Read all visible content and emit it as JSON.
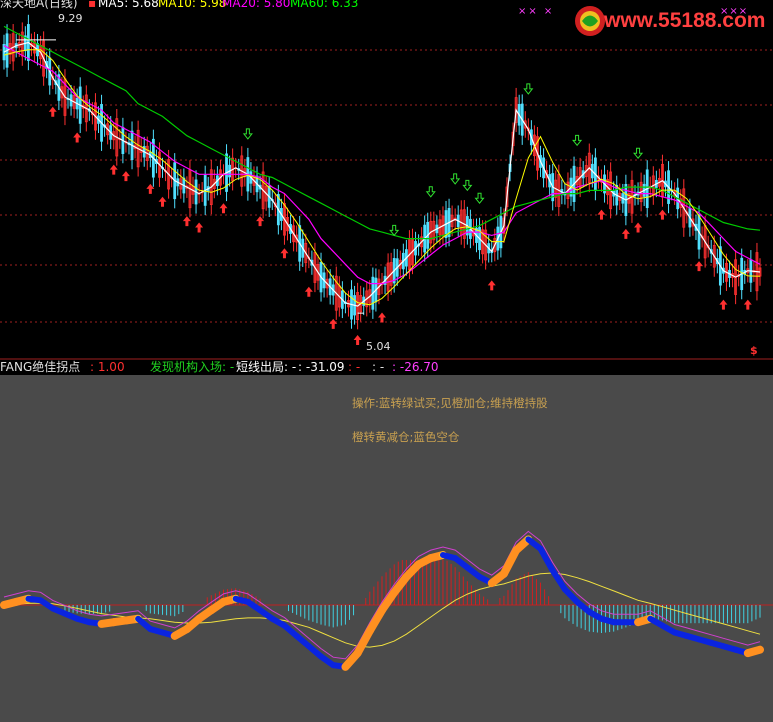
{
  "header": {
    "title": "深天地A(日线)",
    "ma_lines": [
      {
        "label": "MA5: 5.68",
        "color": "#ffffff"
      },
      {
        "label": "MA10: 5.98",
        "color": "#ffff00"
      },
      {
        "label": "MA20: 5.80",
        "color": "#ff00ff"
      },
      {
        "label": "MA60: 6.33",
        "color": "#00ff00"
      }
    ]
  },
  "watermark": {
    "text": "www.55188.com"
  },
  "price_marks": {
    "high": "9.29",
    "low": "5.04",
    "sell_marker": "$"
  },
  "indicator_bar": {
    "name": "FANG绝佳拐点",
    "param": ": 1.00",
    "item1_label": "发现机构入场: -",
    "item2_label": "短线出局: -",
    "item2_value": ": -31.09",
    "item3": ": -",
    "item4": ": -",
    "item5": ": -26.70"
  },
  "notes": {
    "line1": "操作:蓝转绿试买;见橙加仓;维持橙持股",
    "line2": "橙转黄减仓;蓝色空仓"
  },
  "colors": {
    "up": "#ff3030",
    "down": "#50e0ff",
    "ma5": "#ffffff",
    "ma10": "#ffff00",
    "ma20": "#ff00ff",
    "ma60": "#00cc00",
    "orange": "#ff9020",
    "blue": "#0a24e0",
    "green": "#20c020",
    "yellow": "#f0e040",
    "magenta": "#d040d0",
    "bg_sub": "#4a4a4a"
  },
  "chart_data": {
    "type": "line",
    "series": [
      {
        "name": "MA5",
        "role": "close",
        "values": [
          9.1,
          9.2,
          9.25,
          9.1,
          8.7,
          8.4,
          8.3,
          8.2,
          8.0,
          7.8,
          7.7,
          7.6,
          7.5,
          7.3,
          7.1,
          7.0,
          6.9,
          7.0,
          7.2,
          7.3,
          7.2,
          7.0,
          6.8,
          6.5,
          6.2,
          5.9,
          5.6,
          5.4,
          5.2,
          5.15,
          5.3,
          5.5,
          5.7,
          5.9,
          6.1,
          6.3,
          6.4,
          6.5,
          6.4,
          6.2,
          6.0,
          6.4,
          8.2,
          7.9,
          7.4,
          7.0,
          6.9,
          7.1,
          7.3,
          7.1,
          6.9,
          6.8,
          6.9,
          7.0,
          7.1,
          6.9,
          6.6,
          6.3,
          6.0,
          5.7,
          5.6,
          5.7,
          5.68
        ]
      },
      {
        "name": "MA20",
        "values": [
          9.2,
          9.1,
          9.0,
          8.9,
          8.8,
          8.6,
          8.4,
          8.3,
          8.2,
          8.0,
          7.9,
          7.8,
          7.7,
          7.55,
          7.4,
          7.3,
          7.2,
          7.2,
          7.2,
          7.2,
          7.2,
          7.15,
          7.0,
          6.9,
          6.7,
          6.5,
          6.2,
          6.0,
          5.8,
          5.6,
          5.5,
          5.5,
          5.55,
          5.65,
          5.8,
          5.95,
          6.1,
          6.2,
          6.3,
          6.3,
          6.25,
          6.3,
          6.6,
          6.7,
          6.8,
          6.9,
          6.9,
          7.0,
          7.05,
          7.1,
          7.0,
          6.95,
          6.9,
          6.9,
          6.85,
          6.8,
          6.7,
          6.6,
          6.4,
          6.2,
          6.0,
          5.9,
          5.8
        ]
      },
      {
        "name": "MA60",
        "values": [
          9.5,
          9.4,
          9.3,
          9.2,
          9.1,
          9.0,
          8.9,
          8.8,
          8.7,
          8.6,
          8.5,
          8.3,
          8.2,
          8.1,
          7.95,
          7.8,
          7.7,
          7.6,
          7.5,
          7.4,
          7.3,
          7.2,
          7.15,
          7.05,
          6.95,
          6.85,
          6.75,
          6.65,
          6.55,
          6.45,
          6.35,
          6.3,
          6.25,
          6.2,
          6.2,
          6.2,
          6.25,
          6.3,
          6.35,
          6.4,
          6.5,
          6.6,
          6.7,
          6.75,
          6.8,
          6.85,
          6.9,
          6.9,
          6.95,
          6.95,
          6.95,
          7.0,
          7.0,
          7.0,
          6.95,
          6.85,
          6.75,
          6.65,
          6.55,
          6.45,
          6.4,
          6.35,
          6.33
        ]
      }
    ],
    "ylim": [
      4.7,
      9.6
    ],
    "indicator": {
      "main": [
        0,
        2,
        4,
        3,
        -2,
        -5,
        -8,
        -10,
        -11,
        -10,
        -9,
        -8,
        -14,
        -16,
        -18,
        -14,
        -8,
        -3,
        2,
        4,
        2,
        -3,
        -8,
        -12,
        -18,
        -24,
        -30,
        -35,
        -36,
        -28,
        -15,
        -3,
        8,
        18,
        26,
        30,
        32,
        30,
        24,
        18,
        14,
        20,
        35,
        42,
        36,
        22,
        10,
        2,
        -4,
        -8,
        -10,
        -10,
        -10,
        -8,
        -12,
        -16,
        -18,
        -20,
        -22,
        -24,
        -26,
        -28,
        -26
      ],
      "signal": [
        0,
        0.5,
        1,
        1.2,
        0.8,
        -0.5,
        -2,
        -3.5,
        -5,
        -6,
        -7,
        -7.5,
        -8,
        -9,
        -10,
        -10.5,
        -10.5,
        -10,
        -9,
        -8,
        -7.5,
        -7.5,
        -8,
        -9,
        -11,
        -13,
        -16,
        -19,
        -22,
        -24,
        -24.5,
        -23.5,
        -21,
        -17,
        -12,
        -7,
        -2,
        3,
        7,
        10,
        12,
        13.5,
        16,
        18.5,
        20,
        20.5,
        19.5,
        17.5,
        15,
        12,
        9,
        6,
        3,
        1,
        -1,
        -3,
        -5,
        -7,
        -9,
        -11,
        -13,
        -15,
        -17
      ],
      "ylim": [
        -45,
        48
      ]
    }
  }
}
